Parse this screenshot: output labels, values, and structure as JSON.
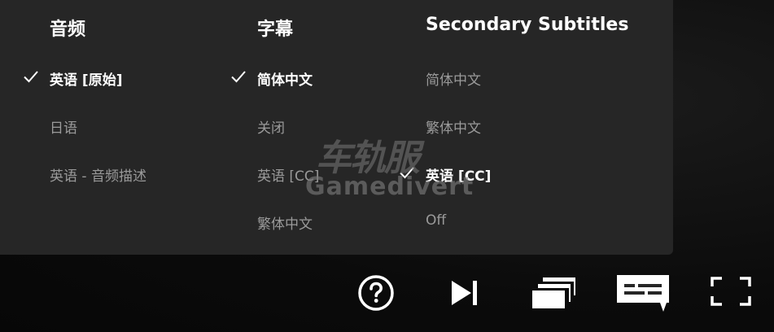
{
  "audio": {
    "header": "音频",
    "options": [
      {
        "label": "英语 [原始]",
        "selected": true
      },
      {
        "label": "日语",
        "selected": false
      },
      {
        "label": "英语 - 音频描述",
        "selected": false
      }
    ]
  },
  "subtitles": {
    "header": "字幕",
    "options": [
      {
        "label": "简体中文",
        "selected": true
      },
      {
        "label": "关闭",
        "selected": false
      },
      {
        "label": "英语 [CC]",
        "selected": false
      },
      {
        "label": "繁体中文",
        "selected": false
      }
    ]
  },
  "secondary_subtitles": {
    "header": "Secondary Subtitles",
    "options": [
      {
        "label": "简体中文",
        "selected": false
      },
      {
        "label": "繁体中文",
        "selected": false
      },
      {
        "label": "英语 [CC]",
        "selected": true
      },
      {
        "label": "Off",
        "selected": false
      }
    ]
  },
  "watermark": {
    "cn_text": "车轨服",
    "en_text": "Gamedivert"
  },
  "controls": [
    {
      "name": "help",
      "icon": "help-circle-icon"
    },
    {
      "name": "next-episode",
      "icon": "skip-next-icon"
    },
    {
      "name": "episodes",
      "icon": "episodes-stack-icon"
    },
    {
      "name": "audio-subtitles",
      "icon": "subtitles-icon"
    },
    {
      "name": "fullscreen",
      "icon": "fullscreen-icon"
    }
  ],
  "colors": {
    "panel_bg": "#262626",
    "selected_text": "#ffffff",
    "unselected_text": "#9a9a9a",
    "icon": "#ffffff"
  }
}
